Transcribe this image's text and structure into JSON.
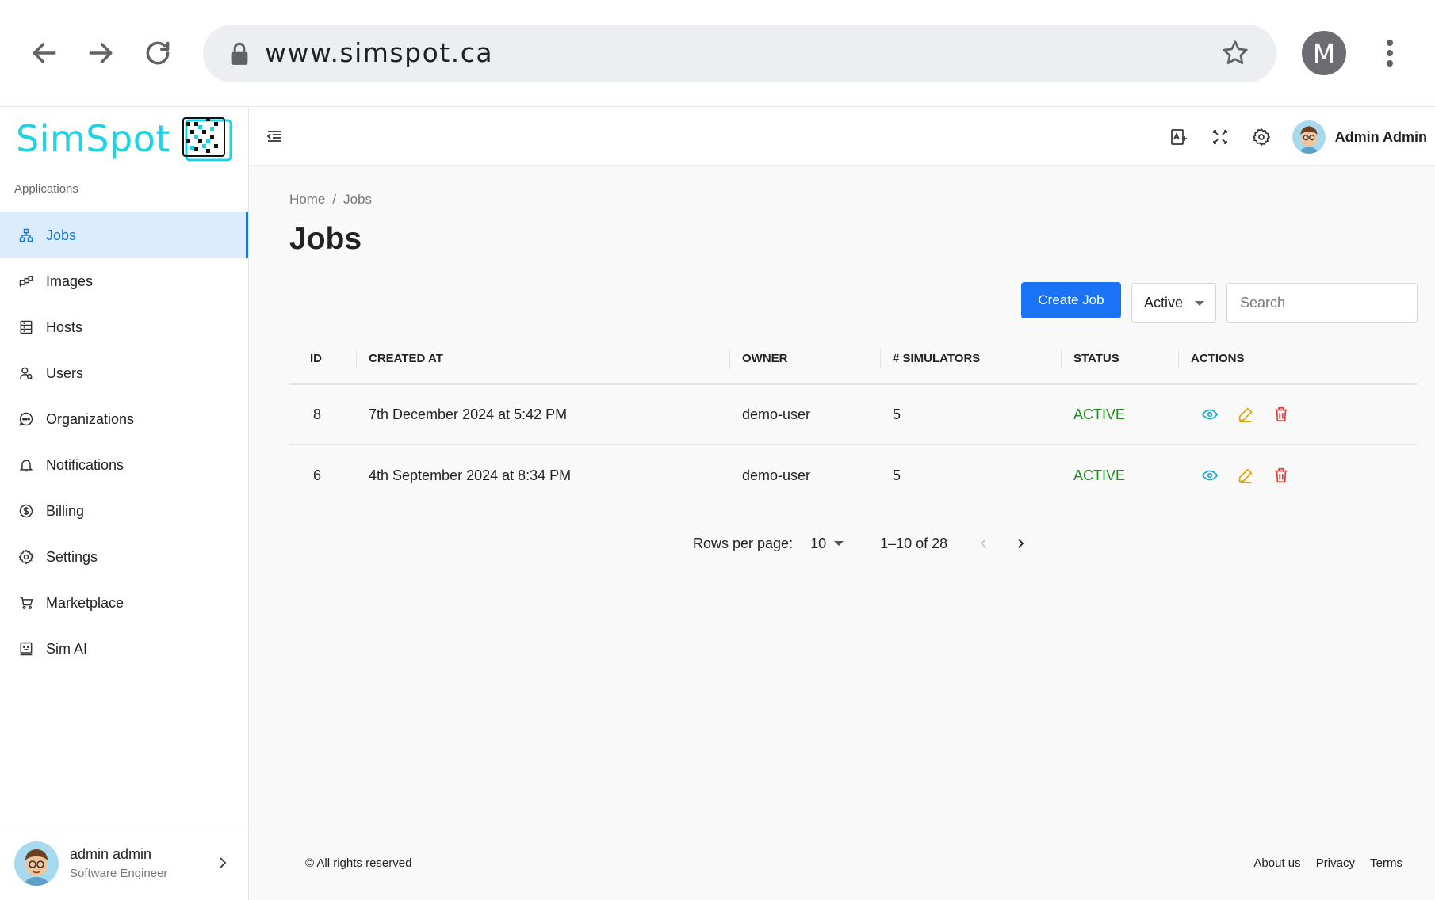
{
  "browser": {
    "url": "www.simspot.ca",
    "profile_initial": "M"
  },
  "sidebar": {
    "logo_text": "SimSpot",
    "section_label": "Applications",
    "items": [
      {
        "label": "Jobs",
        "icon": "sitemap-icon",
        "active": true
      },
      {
        "label": "Images",
        "icon": "images-icon"
      },
      {
        "label": "Hosts",
        "icon": "server-icon"
      },
      {
        "label": "Users",
        "icon": "users-icon"
      },
      {
        "label": "Organizations",
        "icon": "organizations-icon"
      },
      {
        "label": "Notifications",
        "icon": "bell-icon"
      },
      {
        "label": "Billing",
        "icon": "dollar-icon"
      },
      {
        "label": "Settings",
        "icon": "gear-icon"
      },
      {
        "label": "Marketplace",
        "icon": "cart-icon"
      },
      {
        "label": "Sim AI",
        "icon": "robot-icon"
      }
    ],
    "user": {
      "name": "admin admin",
      "role": "Software Engineer"
    }
  },
  "topbar": {
    "username": "Admin Admin"
  },
  "main": {
    "breadcrumb": [
      "Home",
      "Jobs"
    ],
    "breadcrumb_sep": "/",
    "title": "Jobs",
    "create_label": "Create Job",
    "status_filter": "Active",
    "search_placeholder": "Search",
    "table": {
      "columns": [
        "ID",
        "CREATED AT",
        "OWNER",
        "# SIMULATORS",
        "STATUS",
        "ACTIONS"
      ],
      "rows": [
        {
          "id": "8",
          "created_at": "7th December 2024 at 5:42 PM",
          "owner": "demo-user",
          "simulators": "5",
          "status": "ACTIVE"
        },
        {
          "id": "6",
          "created_at": "4th September 2024 at 8:34 PM",
          "owner": "demo-user",
          "simulators": "5",
          "status": "ACTIVE"
        }
      ]
    },
    "pagination": {
      "rows_per_page_label": "Rows per page:",
      "rows_per_page": "10",
      "range": "1–10 of 28"
    }
  },
  "footer": {
    "copyright": "© All rights reserved",
    "links": [
      "About us",
      "Privacy",
      "Terms"
    ]
  },
  "colors": {
    "brand": "#1fd3e6",
    "primary": "#1a73f5",
    "active_status": "#1f8a1f",
    "view_icon": "#1aa8c4",
    "edit_icon": "#e6a200",
    "delete_icon": "#e53935"
  }
}
